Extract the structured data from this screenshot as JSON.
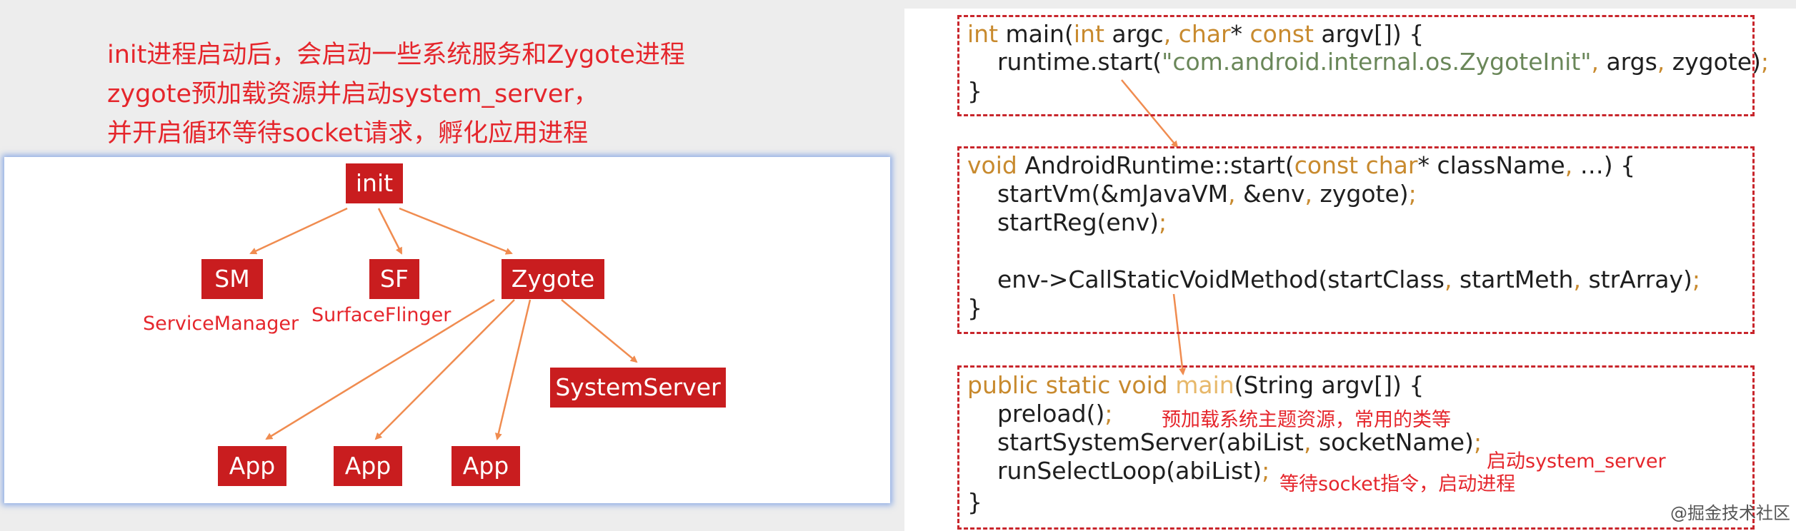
{
  "intro_notes": [
    "init进程启动后，会启动一些系统服务和Zygote进程",
    "zygote预加载资源并启动system_server，",
    "并开启循环等待socket请求，孵化应用进程"
  ],
  "diagram": {
    "nodes": {
      "init": "init",
      "sm": "SM",
      "sf": "SF",
      "zygote": "Zygote",
      "systemserver": "SystemServer",
      "app1": "App",
      "app2": "App",
      "app3": "App"
    },
    "captions": {
      "sm": "ServiceManager",
      "sf": "SurfaceFlinger"
    }
  },
  "code": {
    "block1": {
      "l1": [
        "int",
        " main(",
        "int",
        " argc",
        ",",
        " char",
        "* ",
        "const",
        " argv[]) {"
      ],
      "l2": [
        "    runtime.start(",
        "\"com.android.internal.os.ZygoteInit\"",
        ",",
        " args",
        ",",
        " zygote)",
        ";"
      ],
      "l3": "}"
    },
    "block2": {
      "l1": [
        "void",
        " AndroidRuntime::start(",
        "const char",
        "* className",
        ",",
        " …) {"
      ],
      "l2": [
        "    startVm(&mJavaVM",
        ",",
        " &env",
        ",",
        " zygote)",
        ";"
      ],
      "l3": [
        "    startReg(env)",
        ";"
      ],
      "l4": [
        "    env->CallStaticVoidMethod(startClass",
        ",",
        " startMeth",
        ",",
        " strArray)",
        ";"
      ],
      "l5": "}"
    },
    "block3": {
      "l1": [
        "public static void",
        " main",
        "(String argv[]) {"
      ],
      "l2": [
        "    preload()",
        ";"
      ],
      "l3": [
        "    startSystemServer(abiList",
        ",",
        " socketName)",
        ";"
      ],
      "l4": [
        "    runSelectLoop(abiList)",
        ";"
      ],
      "l5": "}"
    },
    "comments": {
      "preload": "预加载系统主题资源，常用的类等",
      "system_server": "启动system_server",
      "loop": "等待socket指令，启动进程"
    }
  },
  "watermark": "@掘金技术社区",
  "colors": {
    "node_fill": "#c91d1f",
    "arrow": "#f08c50",
    "note_text": "#e5262c",
    "keyword": "#c88a2e",
    "string": "#6a8759",
    "box_border": "#c8262c"
  }
}
